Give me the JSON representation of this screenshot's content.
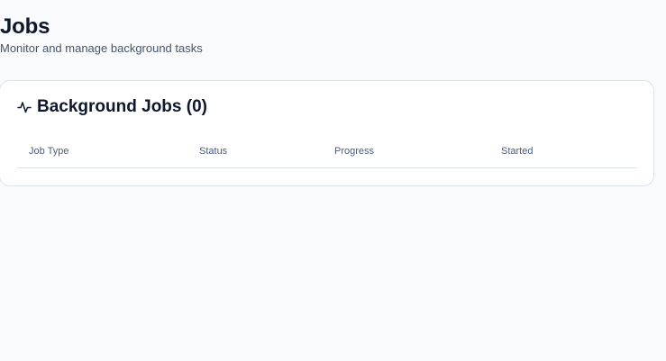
{
  "page": {
    "title": "Jobs",
    "subtitle": "Monitor and manage background tasks"
  },
  "card": {
    "icon": "activity-icon",
    "title": "Background Jobs (0)"
  },
  "table": {
    "columns": [
      "Job Type",
      "Status",
      "Progress",
      "Started"
    ],
    "rows": []
  },
  "colors": {
    "background": "#f8fafc",
    "card": "#ffffff",
    "border": "#dde3ec",
    "text": "#0f172a",
    "muted": "#475569",
    "header_text": "#4b5d80"
  }
}
